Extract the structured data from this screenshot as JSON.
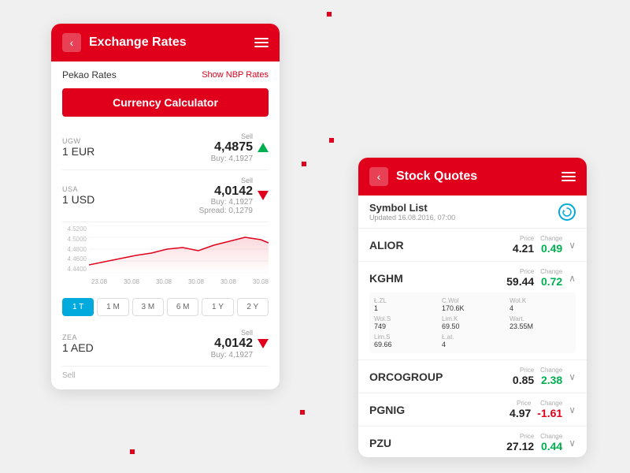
{
  "exchange_card": {
    "header": {
      "title": "Exchange Rates",
      "back_label": "‹",
      "menu_label": "☰"
    },
    "pekao_label": "Pekao Rates",
    "show_nbp_label": "Show NBP Rates",
    "calculator_btn": "Currency Calculator",
    "currencies": [
      {
        "region": "UGW",
        "name": "1 EUR",
        "sell_label": "Sell",
        "sell_value": "4,4875",
        "buy_value": "Buy: 4,1927",
        "direction": "up"
      },
      {
        "region": "USA",
        "name": "1 USD",
        "sell_label": "Sell",
        "sell_value": "4,0142",
        "buy_value": "Buy: 4,1927",
        "spread": "Spread: 0,1279",
        "direction": "down"
      },
      {
        "region": "ZEA",
        "name": "1 AED",
        "sell_label": "Sell",
        "sell_value": "4,0142",
        "buy_value": "Buy: 4,1927",
        "direction": "down"
      }
    ],
    "chart_y_labels": [
      "4.5200",
      "4.5000",
      "4.4800",
      "4.4600",
      "4.4400"
    ],
    "chart_x_labels": [
      "23.08",
      "30.08",
      "30.08",
      "30.08",
      "30.08",
      "30.08"
    ],
    "time_buttons": [
      {
        "label": "1 T",
        "active": true
      },
      {
        "label": "1 M",
        "active": false
      },
      {
        "label": "3 M",
        "active": false
      },
      {
        "label": "6 M",
        "active": false
      },
      {
        "label": "1 Y",
        "active": false
      },
      {
        "label": "2 Y",
        "active": false
      }
    ]
  },
  "stock_card": {
    "header": {
      "title": "Stock Quotes",
      "back_label": "‹",
      "menu_label": "☰"
    },
    "symbol_list": {
      "title": "Symbol List",
      "updated": "Updated 16.08.2016, 07:00"
    },
    "stocks": [
      {
        "name": "ALIOR",
        "price_label": "Price",
        "price": "4.21",
        "change_label": "Change",
        "change": "0.49",
        "change_type": "pos",
        "expanded": false,
        "chevron": "down"
      },
      {
        "name": "KGHM",
        "price_label": "Price",
        "price": "59.44",
        "change_label": "Change",
        "change": "0.72",
        "change_type": "pos",
        "expanded": true,
        "chevron": "up",
        "details": {
          "l_zl_label": "Ł.ZL",
          "l_zl": "1",
          "c_wol_label": "C.Wol",
          "c_wol": "170.6K",
          "wol_k_label": "Wol.K",
          "wol_k": "4",
          "wol_s_label": "Wol.S",
          "wol_s": "749",
          "lim_k_label": "Lim.K",
          "lim_k": "69.50",
          "wart_label": "Wart.",
          "wart": "23.55M",
          "lim_s_label": "Lim.S",
          "lim_s": "69.66",
          "t_at_label": "Ł.at.",
          "t_at": "4"
        }
      },
      {
        "name": "ORCOGROUP",
        "price_label": "Price",
        "price": "0.85",
        "change_label": "Change",
        "change": "2.38",
        "change_type": "pos",
        "expanded": false,
        "chevron": "down"
      },
      {
        "name": "PGNIG",
        "price_label": "Price",
        "price": "4.97",
        "change_label": "Change",
        "change": "-1.61",
        "change_type": "neg",
        "expanded": false,
        "chevron": "down"
      },
      {
        "name": "PZU",
        "price_label": "Price",
        "price": "27.12",
        "change_label": "Change",
        "change": "0.44",
        "change_type": "pos",
        "expanded": false,
        "chevron": "down"
      }
    ]
  }
}
